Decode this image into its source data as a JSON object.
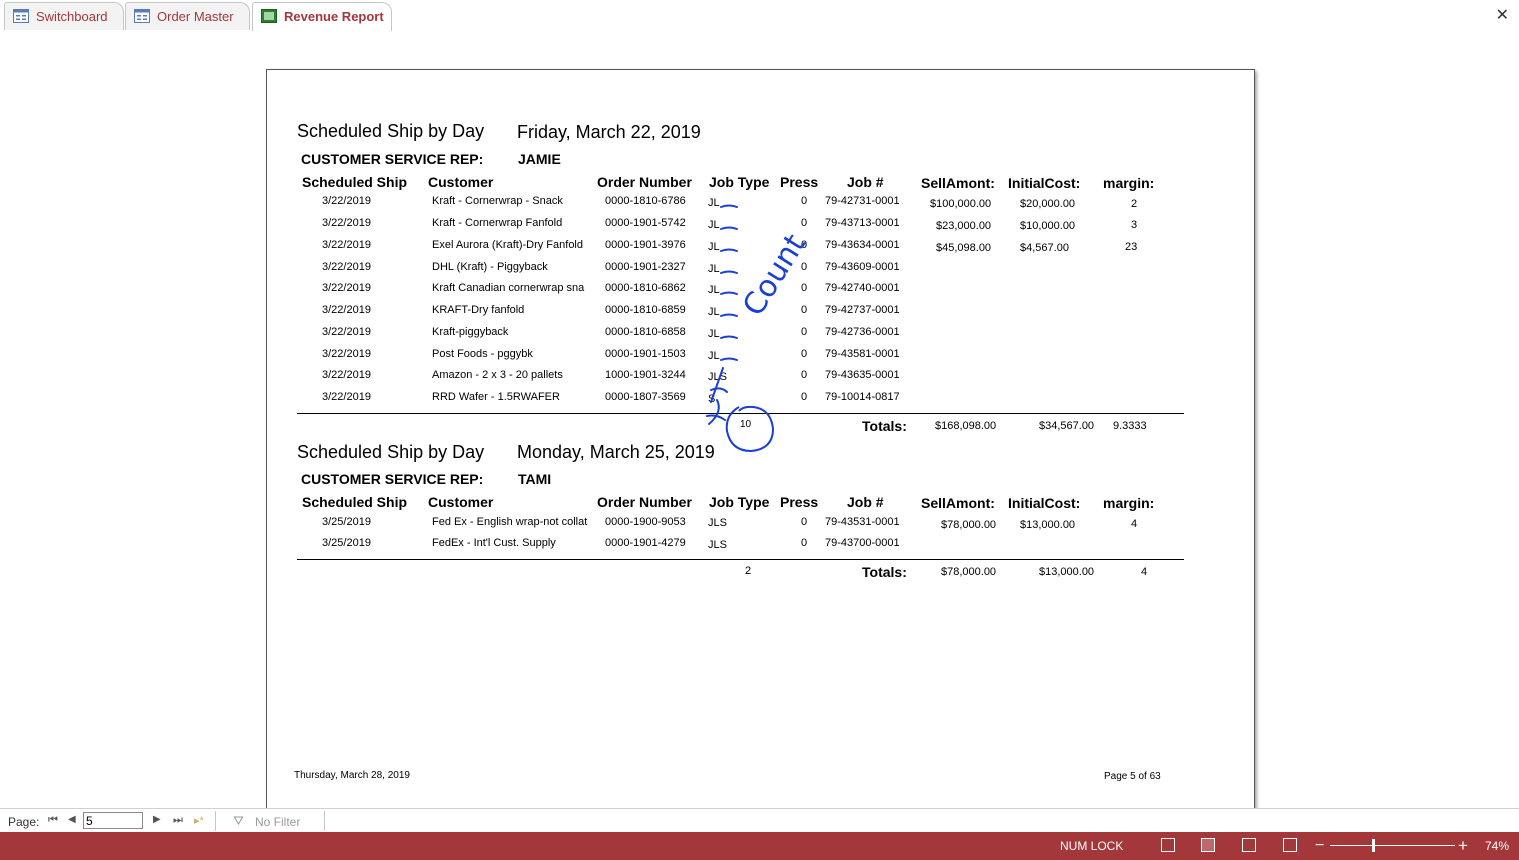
{
  "tabs": [
    {
      "label": "Switchboard",
      "icon": "form-icon"
    },
    {
      "label": "Order Master",
      "icon": "form-icon"
    },
    {
      "label": "Revenue Report",
      "icon": "report-icon"
    }
  ],
  "report": {
    "title_label": "Scheduled Ship by Day",
    "rep_label": "CUSTOMER SERVICE REP:",
    "columns": [
      "Scheduled Ship",
      "Customer",
      "Order Number",
      "Job Type",
      "Press",
      "Job #",
      "SellAmont:",
      "InitialCost:",
      "margin:"
    ],
    "totals_label": "Totals:",
    "groups": [
      {
        "date": "Friday, March 22, 2019",
        "rep": "JAMIE",
        "rows": [
          {
            "ship": "3/22/2019",
            "customer": "Kraft - Cornerwrap - Snack",
            "order": "0000-1810-6786",
            "jobtype": "JL",
            "press": "0",
            "job": "79-42731-0001"
          },
          {
            "ship": "3/22/2019",
            "customer": "Kraft - Cornerwrap Fanfold",
            "order": "0000-1901-5742",
            "jobtype": "JL",
            "press": "0",
            "job": "79-43713-0001"
          },
          {
            "ship": "3/22/2019",
            "customer": "Exel Aurora (Kraft)-Dry Fanfold",
            "order": "0000-1901-3976",
            "jobtype": "JL",
            "press": "0",
            "job": "79-43634-0001"
          },
          {
            "ship": "3/22/2019",
            "customer": "DHL (Kraft) - Piggyback",
            "order": "0000-1901-2327",
            "jobtype": "JL",
            "press": "0",
            "job": "79-43609-0001"
          },
          {
            "ship": "3/22/2019",
            "customer": "Kraft Canadian cornerwrap sna",
            "order": "0000-1810-6862",
            "jobtype": "JL",
            "press": "0",
            "job": "79-42740-0001"
          },
          {
            "ship": "3/22/2019",
            "customer": "KRAFT-Dry fanfold",
            "order": "0000-1810-6859",
            "jobtype": "JL",
            "press": "0",
            "job": "79-42737-0001"
          },
          {
            "ship": "3/22/2019",
            "customer": "Kraft-piggyback",
            "order": "0000-1810-6858",
            "jobtype": "JL",
            "press": "0",
            "job": "79-42736-0001"
          },
          {
            "ship": "3/22/2019",
            "customer": "Post Foods - pggybk",
            "order": "0000-1901-1503",
            "jobtype": "JL",
            "press": "0",
            "job": "79-43581-0001"
          },
          {
            "ship": "3/22/2019",
            "customer": "Amazon  - 2 x 3 - 20 pallets",
            "order": "1000-1901-3244",
            "jobtype": "JLS",
            "press": "0",
            "job": "79-43635-0001"
          },
          {
            "ship": "3/22/2019",
            "customer": "RRD Wafer - 1.5RWAFER",
            "order": "0000-1807-3569",
            "jobtype": "S",
            "press": "0",
            "job": "79-10014-0817"
          }
        ],
        "amounts": [
          {
            "sell": "$100,000.00",
            "cost": "$20,000.00",
            "margin": "2"
          },
          {
            "sell": "$23,000.00",
            "cost": "$10,000.00",
            "margin": "3"
          },
          {
            "sell": "$45,098.00",
            "cost": "$4,567.00",
            "margin": "23"
          }
        ],
        "count": "10",
        "total_sell": "$168,098.00",
        "total_cost": "$34,567.00",
        "total_margin": "9.3333"
      },
      {
        "date": "Monday, March 25, 2019",
        "rep": "TAMI",
        "rows": [
          {
            "ship": "3/25/2019",
            "customer": "Fed Ex - English wrap-not collat",
            "order": "0000-1900-9053",
            "jobtype": "JLS",
            "press": "0",
            "job": "79-43531-0001"
          },
          {
            "ship": "3/25/2019",
            "customer": "FedEx - Int'l Cust. Supply",
            "order": "0000-1901-4279",
            "jobtype": "JLS",
            "press": "0",
            "job": "79-43700-0001"
          }
        ],
        "amounts": [
          {
            "sell": "$78,000.00",
            "cost": "$13,000.00",
            "margin": "4"
          }
        ],
        "count": "2",
        "total_sell": "$78,000.00",
        "total_cost": "$13,000.00",
        "total_margin": "4"
      }
    ],
    "annotation_text": "Count",
    "footer_date": "Thursday, March 28, 2019",
    "footer_page": "Page 5 of 63"
  },
  "navbar": {
    "page_label": "Page:",
    "page_value": "5",
    "filter_label": "No Filter"
  },
  "statusbar": {
    "num_lock": "NUM LOCK",
    "zoom": "74%"
  },
  "colors": {
    "accent": "#a4373a",
    "ink": "#1a3fd8"
  }
}
